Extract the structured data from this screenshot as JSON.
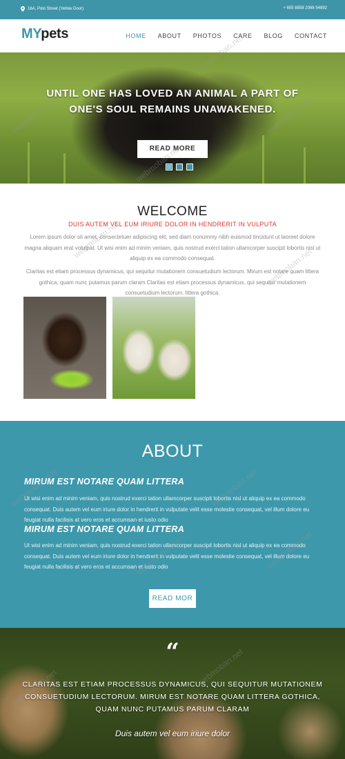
{
  "topbar": {
    "address": "16A, Polo Street (Yellow Door)",
    "phone": "+ 655 8858 2068 54892",
    "pin_icon": "map-pin-icon"
  },
  "brand": {
    "logo_part1": "MY",
    "logo_part2": "pets"
  },
  "nav": {
    "items": [
      {
        "label": "HOME",
        "active": true
      },
      {
        "label": "ABOUT",
        "active": false
      },
      {
        "label": "PHOTOS",
        "active": false
      },
      {
        "label": "CARE",
        "active": false
      },
      {
        "label": "BLOG",
        "active": false
      },
      {
        "label": "CONTACT",
        "active": false
      }
    ]
  },
  "hero": {
    "title_line1": "UNTIL ONE HAS LOVED AN ANIMAL A PART OF",
    "title_line2": "ONE'S SOUL REMAINS UNAWAKENED.",
    "button": "READ MORE",
    "slides": 3,
    "active_slide": 1
  },
  "welcome": {
    "title": "WELCOME",
    "subtitle": "DUIS AUTEM VEL EUM IRIURE DOLOR IN HENDRERIT IN VULPUTA",
    "paragraph1": "Lorem ipsum dolor sit amet, consectetuer adipiscing elit, sed diam nonummy nibh euismod tincidunt ut laoreet dolore magna aliquam erat volutpat. Ut wisi enim ad minim veniam, quis nostrud exerci tation ullamcorper suscipit lobortis nisl ut aliquip ex ea commodo consequat.",
    "paragraph2": "Claritas est etiam processus dynamicus, qui sequitur mutationem consuetudium lectorum. Mirum est notare quam littera gothica, quam nunc putamus parum claram Claritas est etiam processus dynamicus, qui sequitur mutationem consuetudium lectorum. littera gothica."
  },
  "about": {
    "title": "ABOUT",
    "heading1": "MIRUM EST NOTARE QUAM LITTERA",
    "text1": "Ut wisi enim ad minim veniam, quis nostrud exerci tation ullamcorper suscipit lobortis nisl ut aliquip ex ea commodo consequat. Duis autem vel eum iriure dolor in hendrerit in vulputate velit esse molestie consequat, vel illum dolore eu feugiat nulla facilisis at vero eros et accumsan et iusto odio",
    "heading2": "MIRUM EST NOTARE QUAM LITTERA",
    "text2": "Ut wisi enim ad minim veniam, quis nostrud exerci tation ullamcorper suscipit lobortis nisl ut aliquip ex ea commodo consequat. Duis autem vel eum iriure dolor in hendrerit in vulputate velit esse molestie consequat, vel illum dolore eu feugiat nulla facilisis at vero eros et accumsan et iusto odio",
    "button": "READ MOR"
  },
  "testimonial": {
    "quote_mark": "“",
    "text": "CLARITAS EST ETIAM PROCESSUS DYNAMICUS, QUI SEQUITUR MUTATIONEM CONSUETUDIUM LECTORUM. MIRUM EST NOTARE QUAM LITTERA GOTHICA, QUAM NUNC PUTAMUS PARUM CLARAM",
    "author": "Duis autem vel eum iriure dolor"
  },
  "watermark": "webmoban.net",
  "colors": {
    "accent": "#3f95a8",
    "sub_red": "#e0362b"
  }
}
